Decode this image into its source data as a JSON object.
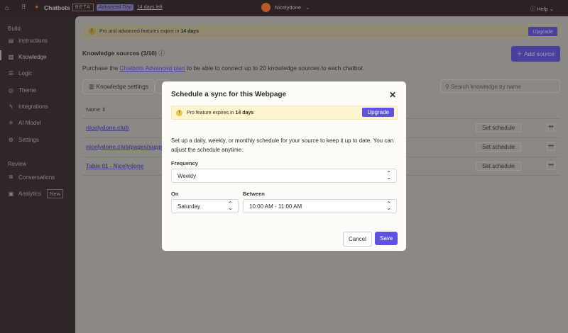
{
  "topbar": {
    "app": "Chatbots",
    "beta": "BETA",
    "trial": "Advanced Trial",
    "days_left": "14 days left",
    "user": "Nicelydone",
    "help": "Help"
  },
  "sidebar": {
    "build": "Build",
    "review": "Review",
    "items": [
      {
        "label": "Instructions",
        "icon": "document-icon"
      },
      {
        "label": "Knowledge",
        "icon": "book-icon"
      },
      {
        "label": "Logic",
        "icon": "list-icon"
      },
      {
        "label": "Theme",
        "icon": "palette-icon"
      },
      {
        "label": "Integrations",
        "icon": "bolt-icon"
      },
      {
        "label": "AI Model",
        "icon": "sparkle-icon"
      },
      {
        "label": "Settings",
        "icon": "gear-icon"
      }
    ],
    "review_items": [
      {
        "label": "Conversations",
        "icon": "chat-icon"
      },
      {
        "label": "Analytics",
        "icon": "chart-icon",
        "badge": "New"
      }
    ]
  },
  "main": {
    "banner_text": "Pro and advanced features expire in ",
    "banner_bold": "14 days",
    "upgrade": "Upgrade",
    "title": "Knowledge sources (3/10)",
    "add_source": "Add source",
    "purchase_pre": "Purchase the ",
    "purchase_link": "Chatbots Advanced plan",
    "purchase_post": " to be able to connect up to 20 knowledge sources to each chatbot.",
    "knowledge_settings": "Knowledge settings",
    "search_placeholder": "Search knowledge by name",
    "col_name": "Name",
    "rows": [
      {
        "name": "nicelydone.club",
        "action": "Set schedule"
      },
      {
        "name": "nicelydone.club/pages/support",
        "action": "Set schedule"
      },
      {
        "name": "Table 01 - Nicelydone",
        "action": "Set schedule"
      }
    ]
  },
  "modal": {
    "title": "Schedule a sync for this Webpage",
    "banner_text": "Pro feature expires in ",
    "banner_bold": "14 days",
    "upgrade": "Upgrade",
    "description": "Set up a daily, weekly, or monthly schedule for your source to keep it up to date. You can adjust the schedule anytime.",
    "frequency_label": "Frequency",
    "frequency": "Weekly",
    "on_label": "On",
    "on": "Saturday",
    "between_label": "Between",
    "between": "10:00 AM - 11:00 AM",
    "cancel": "Cancel",
    "save": "Save"
  },
  "colors": {
    "accent": "#5f52e0"
  }
}
